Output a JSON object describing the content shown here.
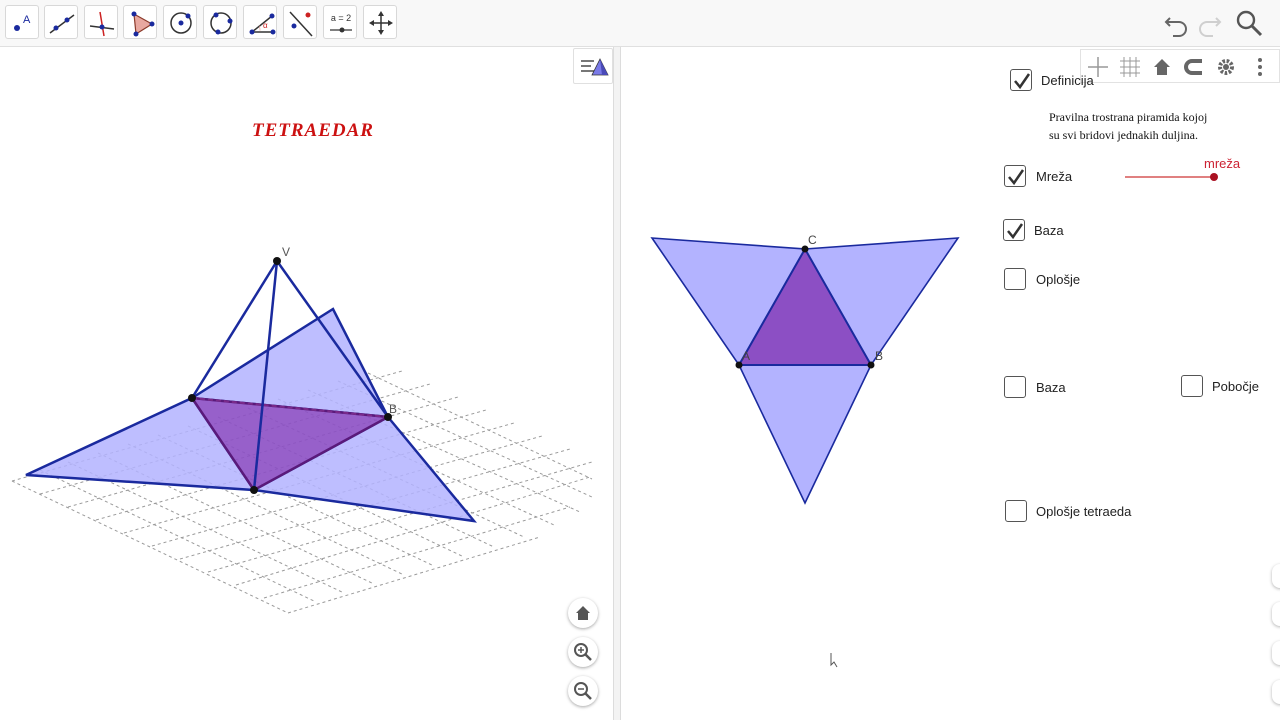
{
  "toolbar": {
    "tools": [
      {
        "name": "point-tool",
        "label": "A"
      },
      {
        "name": "line-tool",
        "label": ""
      },
      {
        "name": "perpendicular-line-tool",
        "label": ""
      },
      {
        "name": "polygon-tool",
        "label": ""
      },
      {
        "name": "circle-tool",
        "label": ""
      },
      {
        "name": "circle-through-points-tool",
        "label": ""
      },
      {
        "name": "angle-tool",
        "label": "α"
      },
      {
        "name": "reflect-tool",
        "label": ""
      },
      {
        "name": "slider-tool",
        "label": "a = 2"
      },
      {
        "name": "move-graphics-tool",
        "label": ""
      }
    ],
    "undo_icon": "undo-icon",
    "redo_icon": "redo-icon",
    "search_icon": "search-icon"
  },
  "left_view": {
    "title": "TETRAEDAR",
    "vertex_labels": {
      "v": "V",
      "b": "B"
    },
    "nav": [
      "home-icon",
      "zoom-in-icon",
      "zoom-out-icon"
    ]
  },
  "right_view": {
    "stylebar_icons": [
      "axes-icon",
      "grid-icon",
      "home-icon",
      "magnet-icon",
      "gear-icon",
      "more-vertical-icon"
    ],
    "net_labels": {
      "a": "A",
      "b": "B",
      "c": "C"
    },
    "checkboxes": {
      "definicija": {
        "label": "Definicija",
        "checked": true
      },
      "mreza": {
        "label": "Mreža",
        "checked": true
      },
      "baza_top": {
        "label": "Baza",
        "checked": true
      },
      "oplosje": {
        "label": "Oplošje",
        "checked": false
      },
      "baza_bottom": {
        "label": "Baza",
        "checked": false
      },
      "pobocje": {
        "label": "Pobočje",
        "checked": false
      },
      "oplosje_tetraeda": {
        "label": "Oplošje tetraeda",
        "checked": false
      }
    },
    "definition_line1": "Pravilna trostrana piramida kojoj",
    "definition_line2": "su svi bridovi jednakih duljina.",
    "slider": {
      "label": "mreža",
      "value": 1,
      "color": "#cc2233"
    }
  },
  "colors": {
    "face_fill": "#b3b3ff",
    "base_fill": "#8c4fc4",
    "edge_blue": "#1a2a9e",
    "title_red": "#cc1111"
  }
}
